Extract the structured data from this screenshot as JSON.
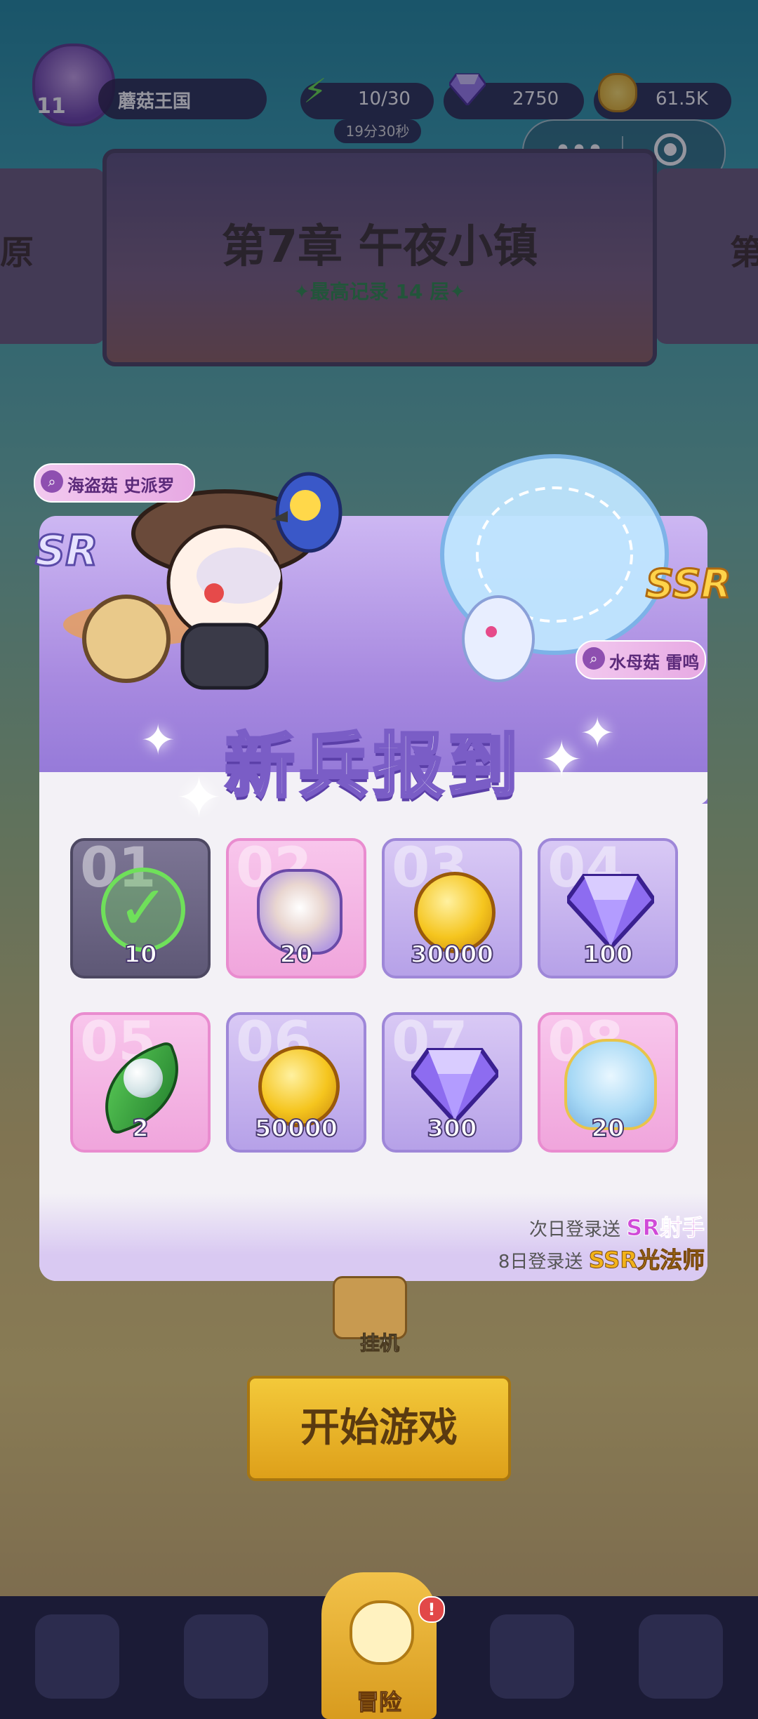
{
  "top_bar": {
    "level": "11",
    "player_name": "蘑菇王国",
    "energy": "10/30",
    "energy_timer": "19分30秒",
    "gems": "2750",
    "coins": "61.5K"
  },
  "mini_program": {
    "more_label": "•••"
  },
  "chapter": {
    "left_neighbor_text": "原",
    "right_neighbor_text": "第",
    "title": "第7章 午夜小镇",
    "record": "✦最高记录 14 层✦"
  },
  "popup": {
    "title": "新兵报到",
    "hero_left": {
      "rarity": "SR",
      "name": "海盗菇 史派罗"
    },
    "hero_right": {
      "rarity": "SSR",
      "name": "水母菇 雷鸣"
    },
    "rewards": [
      {
        "day": "01",
        "type": "claimed",
        "qty": "10",
        "style": "done"
      },
      {
        "day": "02",
        "type": "hero-fragment-sr",
        "qty": "20",
        "style": "pink"
      },
      {
        "day": "03",
        "type": "coin",
        "qty": "30000",
        "style": "purple"
      },
      {
        "day": "04",
        "type": "gem",
        "qty": "100",
        "style": "purple"
      },
      {
        "day": "05",
        "type": "pearl-leaf",
        "qty": "2",
        "style": "pink"
      },
      {
        "day": "06",
        "type": "coin",
        "qty": "50000",
        "style": "purple"
      },
      {
        "day": "07",
        "type": "gem",
        "qty": "300",
        "style": "purple"
      },
      {
        "day": "08",
        "type": "hero-fragment-ssr",
        "qty": "20",
        "style": "pink"
      }
    ],
    "promo_line1_prefix": "次日登录送",
    "promo_line1_highlight": "SR射手",
    "promo_line2_prefix": "8日登录送",
    "promo_line2_highlight": "SSR光法师"
  },
  "lobby": {
    "idle_label": "挂机",
    "start_button": "开始游戏"
  },
  "bottom_nav": {
    "adventure_label": "冒险",
    "alert": "!"
  },
  "colors": {
    "accent_purple": "#8f74d6",
    "sr_purple": "#d04ad8",
    "ssr_gold": "#f2b21a",
    "claimed_green": "#6fe05a"
  }
}
